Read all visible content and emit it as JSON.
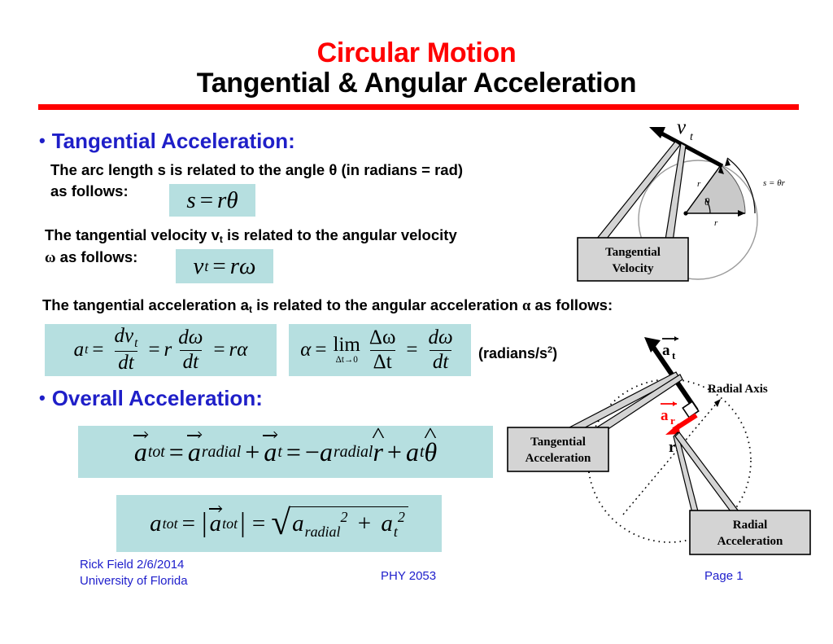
{
  "slide": {
    "title_main": "Circular Motion",
    "title_sub": "Tangential & Angular Acceleration",
    "accent_rule_color": "#ff0000",
    "highlight_color": "#b6dfe0",
    "heading_color": "#1f1fc8",
    "radial_arrow_color": "#ff0000"
  },
  "sections": {
    "tangential": {
      "bullet": "•",
      "heading": "Tangential Acceleration:",
      "para1_line1": "The arc length s is related to the angle θ (in radians = rad)",
      "para1_line2": "as follows:",
      "para2_line1_a": "The tangential velocity v",
      "para2_line1_sub": "t",
      "para2_line1_b": " is related to the angular velocity",
      "para2_line2_omega": "ω",
      "para2_line2_rest": " as follows:",
      "para3_a": "The tangential acceleration a",
      "para3_sub": "t",
      "para3_b": " is related to the angular acceleration ",
      "para3_alpha": "α",
      "para3_c": " as follows:",
      "units_note": "(radians/s",
      "units_note_sup": "2",
      "units_note_end": ")"
    },
    "overall": {
      "bullet": "•",
      "heading": "Overall Acceleration:"
    }
  },
  "equations": {
    "eq_s": {
      "id": "s-equals-r-theta",
      "latex": "s = r\\theta",
      "parts": {
        "s": "s",
        "eq": "=",
        "r": "r",
        "theta": "θ"
      }
    },
    "eq_vt": {
      "id": "vt-equals-r-omega",
      "latex": "v_t = r\\omega",
      "parts": {
        "v": "v",
        "sub_t": "t",
        "eq": "=",
        "r": "r",
        "omega": "ω"
      }
    },
    "eq_at": {
      "id": "at-derivative",
      "latex": "a_t = \\frac{dv_t}{dt} = r\\frac{d\\omega}{dt} = r\\alpha",
      "parts": {
        "a": "a",
        "sub_t": "t",
        "eq1": "=",
        "num1_d": "d",
        "num1_v": "v",
        "num1_sub": "t",
        "den1_d": "d",
        "den1_t": "t",
        "eq2": "=",
        "r": "r",
        "num2_d": "d",
        "num2_omega": "ω",
        "den2_d": "d",
        "den2_t": "t",
        "eq3": "=",
        "r2": "r",
        "alpha": "α"
      }
    },
    "eq_alpha": {
      "id": "alpha-limit",
      "latex": "\\alpha = \\lim_{\\Delta t \\to 0} \\frac{\\Delta\\omega}{\\Delta t} = \\frac{d\\omega}{dt}",
      "parts": {
        "alpha": "α",
        "eq1": "=",
        "lim": "lim",
        "lim_sub": "Δt→0",
        "num1": "Δω",
        "den1": "Δt",
        "eq2": "=",
        "num2_d": "d",
        "num2_omega": "ω",
        "den2_d": "d",
        "den2_t": "t"
      }
    },
    "eq_atot_vector": {
      "id": "a-tot-vector-sum",
      "latex": "\\vec{a}_{tot} = \\vec{a}_{radial} + \\vec{a}_t = -a_{radial}\\hat{r} + a_t\\hat{\\theta}",
      "parts": {
        "a1": "a",
        "sub1": "tot",
        "eq1": "=",
        "a2": "a",
        "sub2": "radial",
        "plus1": "+",
        "a3": "a",
        "sub3": "t",
        "eq2": "=",
        "minus": "−",
        "a4": "a",
        "sub4": "radial",
        "rhat": "r",
        "plus2": "+",
        "a5": "a",
        "sub5": "t",
        "thetahat": "θ"
      }
    },
    "eq_atot_mag": {
      "id": "a-tot-magnitude",
      "latex": "a_{tot} = |\\vec{a}_{tot}| = \\sqrt{a_{radial}^2 + a_t^2}",
      "parts": {
        "a1": "a",
        "sub1": "tot",
        "eq1": "=",
        "bar_l": "|",
        "a2": "a",
        "sub2": "tot",
        "bar_r": "|",
        "eq2": "=",
        "radical": "√",
        "a3": "a",
        "sub3": "radial",
        "sup3": "2",
        "plus": "+",
        "a4": "a",
        "sub4": "t",
        "sup4": "2"
      }
    }
  },
  "figures": {
    "tangential_velocity": {
      "name": "tangential-velocity-figure",
      "arrow_label": "v",
      "arrow_label_sub": "t",
      "angle_label": "θ",
      "radius_label_1": "r",
      "radius_label_2": "r",
      "arc_label": "s = θr",
      "callout_line1": "Tangential",
      "callout_line2": "Velocity"
    },
    "overall_acceleration": {
      "name": "overall-acceleration-figure",
      "tangential_arrow_label": "a",
      "tangential_arrow_sub": "t",
      "radial_arrow_label": "a",
      "radial_arrow_sub": "r",
      "radial_axis_label": "Radial Axis",
      "radius_label": "r",
      "callout_tangential_line1": "Tangential",
      "callout_tangential_line2": "Acceleration",
      "callout_radial_line1": "Radial",
      "callout_radial_line2": "Acceleration"
    }
  },
  "footer": {
    "author_line1": "Rick Field 2/6/2014",
    "author_line2": "University of Florida",
    "course": "PHY 2053",
    "page": "Page 1"
  }
}
